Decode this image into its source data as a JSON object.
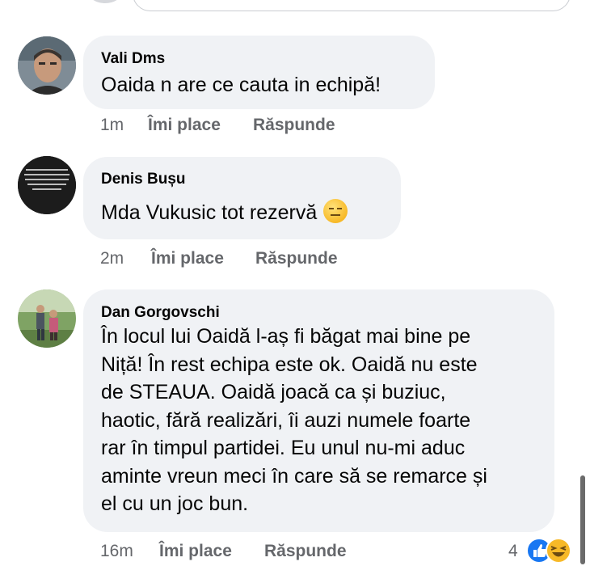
{
  "comments": [
    {
      "author": "Vali Dms",
      "text": "Oaida n are ce cauta in echipă!",
      "time": "1m",
      "like_label": "Îmi place",
      "reply_label": "Răspunde",
      "avatar": "man-portrait-avatar"
    },
    {
      "author": "Denis Bușu",
      "text": "Mda Vukusic tot rezervă",
      "emoji": "expressionless-face-emoji",
      "time": "2m",
      "like_label": "Îmi place",
      "reply_label": "Răspunde",
      "avatar": "black-tshirt-text-avatar"
    },
    {
      "author": "Dan Gorgovschi",
      "lines": [
        "În locul lui Oaidă l-aș fi băgat mai bine pe",
        "Niță! În rest echipa este ok. Oaidă nu este",
        "de STEAUA. Oaidă joacă ca și buziuc,",
        "haotic, fără realizări, îi auzi numele foarte",
        "rar în timpul partidei. Eu unul nu-mi aduc",
        "aminte vreun meci în care să se remarce și",
        "el cu un joc bun."
      ],
      "time": "16m",
      "like_label": "Îmi place",
      "reply_label": "Răspunde",
      "avatar": "couple-garden-avatar",
      "reactions": {
        "count": "4",
        "types": [
          "like-icon",
          "haha-icon"
        ]
      }
    }
  ],
  "colors": {
    "bubble": "#f0f2f5",
    "meta": "#65676b",
    "like_blue": "#1877f2",
    "haha_yellow": "#f7b928"
  }
}
